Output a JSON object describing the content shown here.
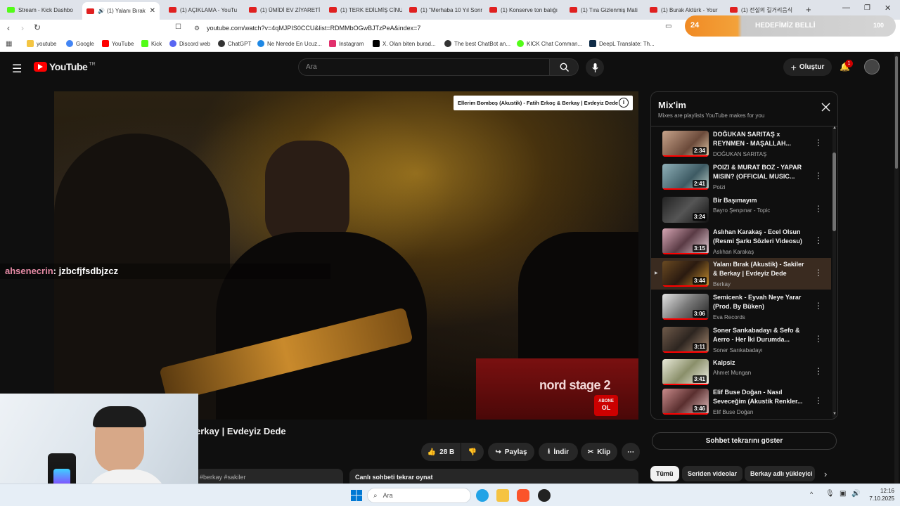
{
  "tabs": [
    {
      "label": "Stream - Kick Dashbo",
      "color": "#53fc18"
    },
    {
      "label": "(1) Yalanı Bırak",
      "color": "#ff0000"
    },
    {
      "label": "(1) AÇIKLAMA - YouTu",
      "color": "#ff0000"
    },
    {
      "label": "(1) ÜMİDİ EV ZİYARETİ",
      "color": "#ff0000"
    },
    {
      "label": "(1) TERK EDİLMİŞ CİNU",
      "color": "#ff0000"
    },
    {
      "label": "(1) \"Merhaba 10 Yıl Sonr",
      "color": "#ff0000"
    },
    {
      "label": "(1) Konserve ton balığı",
      "color": "#ff0000"
    },
    {
      "label": "(1) Tıra Gizlenmiş Mati",
      "color": "#ff0000"
    },
    {
      "label": "(1) Burak Aktürk - Your",
      "color": "#ff0000"
    },
    {
      "label": "(1) 전설의 길거리음식",
      "color": "#ff0000"
    }
  ],
  "browser": {
    "url": "youtube.com/watch?v=4qMJPIS0CCU&list=RDMMbOGwBJTzPeA&index=7",
    "extension_count": "24",
    "extension_text": "HEDEFİMİZ BELLİ",
    "extension_value": "100",
    "new_tab": "+"
  },
  "bookmarks": [
    {
      "label": "youtube",
      "color": "#f4c542"
    },
    {
      "label": "Google",
      "color": "#4285f4"
    },
    {
      "label": "YouTube",
      "color": "#ff0000"
    },
    {
      "label": "Kick",
      "color": "#53fc18"
    },
    {
      "label": "Discord web",
      "color": "#5865f2"
    },
    {
      "label": "ChatGPT",
      "color": "#333333"
    },
    {
      "label": "Ne Nerede En Ucuz...",
      "color": "#1e88e5"
    },
    {
      "label": "Instagram",
      "color": "#e1306c"
    },
    {
      "label": "X. Olan biten burad...",
      "color": "#000000"
    },
    {
      "label": "The best ChatBot an...",
      "color": "#333333"
    },
    {
      "label": "KICK Chat Comman...",
      "color": "#53fc18"
    },
    {
      "label": "DeepL Translate: Th...",
      "color": "#0f2b46"
    }
  ],
  "youtube": {
    "logo_text": "YouTube",
    "logo_sup": "TR",
    "search_placeholder": "Ara",
    "create_label": "Oluştur",
    "notification_count": "1",
    "video_overlay_title": "Ellerim Bomboş (Akustik) - Fatih Erkoç & Berkay | Evdeyiz Dede",
    "subscribe_watermark_1": "ABONE",
    "subscribe_watermark_2": "OL",
    "video_title_partial": "erkay | Evdeyiz Dede",
    "like_count": "28 B",
    "share_label": "Paylaş",
    "download_label": "İndir",
    "clip_label": "Klip",
    "hashtags_partial": "#berkay #sakiler",
    "replay_chat_label": "Canlı sohbeti tekrar oynat",
    "show_chat_replay_label": "Sohbet tekrarını göster",
    "filters": [
      "Tümü",
      "Seriden videolar",
      "Berkay adlı yükleyici"
    ],
    "keyboard_brand": "nord stage 2"
  },
  "mix": {
    "title": "Mix'im",
    "subtitle": "Mixes are playlists YouTube makes for you",
    "items": [
      {
        "title": "DOĞUKAN SARITAŞ x REYNMEN - MAŞALLAH...",
        "channel": "DOĞUKAN SARITAŞ",
        "duration": "2:34"
      },
      {
        "title": "POIZI & MURAT BOZ - YAPAR MISIN? (OFFICIAL MUSIC...",
        "channel": "Poizi",
        "duration": "2:41"
      },
      {
        "title": "Bir Başımayım",
        "channel": "Bayro Şenpınar - Topic",
        "duration": "3:24"
      },
      {
        "title": "Aslıhan Karakaş - Ecel Olsun (Resmi Şarkı Sözleri Videosu)",
        "channel": "Aslıhan Karakaş",
        "duration": "3:15"
      },
      {
        "title": "Yalanı Bırak (Akustik) - Sakiler & Berkay | Evdeyiz Dede",
        "channel": "Berkay",
        "duration": "3:44"
      },
      {
        "title": "Semicenk - Eyvah Neye Yarar (Prod. By Büken)",
        "channel": "Eva Records",
        "duration": "3:06"
      },
      {
        "title": "Soner Sarıkabadayı & Sefo & Aerro - Her İki Durumda...",
        "channel": "Soner Sarıkabadayı",
        "duration": "3:11"
      },
      {
        "title": "Kalpsiz",
        "channel": "Ahmet Mungan",
        "duration": "3:41"
      },
      {
        "title": "Elif Buse Doğan - Nasıl Seveceğim (Akustik Renkler...",
        "channel": "Elif Buse Doğan",
        "duration": "3:46"
      }
    ]
  },
  "stream_chat": {
    "username": "ahsenecrin",
    "message": ": jzbcfjfsdbjzcz"
  },
  "taskbar": {
    "search_placeholder": "Ara",
    "time": "12:16",
    "date": "7.10.2025"
  }
}
